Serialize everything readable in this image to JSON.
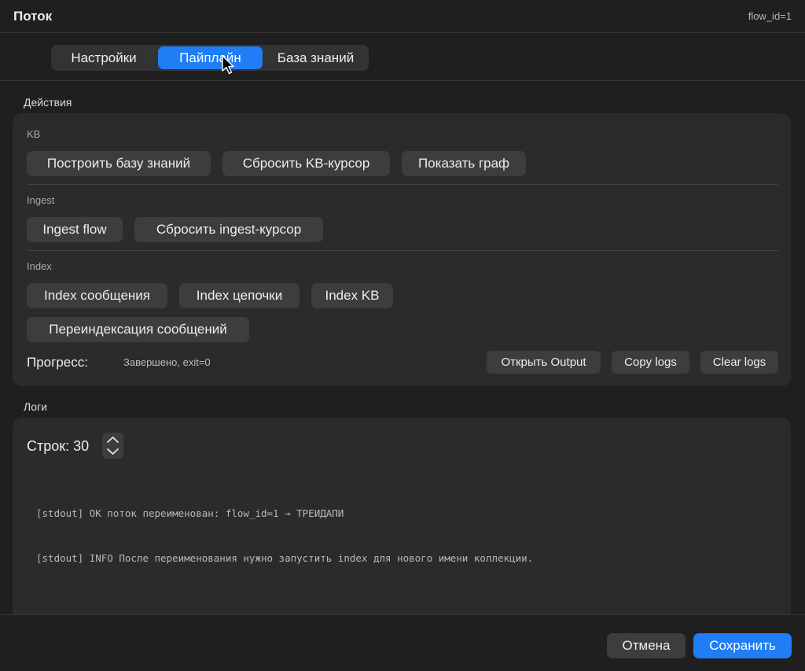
{
  "window": {
    "title": "Поток",
    "flow_id": "flow_id=1"
  },
  "tabs": [
    {
      "label": "Настройки",
      "active": false
    },
    {
      "label": "Пайплайн",
      "active": true
    },
    {
      "label": "База знаний",
      "active": false
    }
  ],
  "actions": {
    "section_label": "Действия",
    "kb": {
      "label": "KB",
      "buttons": [
        "Построить базу знаний",
        "Сбросить KB-курсор",
        "Показать граф"
      ]
    },
    "ingest": {
      "label": "Ingest",
      "buttons": [
        "Ingest flow",
        "Сбросить ingest-курсор"
      ]
    },
    "index": {
      "label": "Index",
      "buttons": [
        "Index сообщения",
        "Index цепочки",
        "Index KB",
        "Переиндексация сообщений"
      ]
    },
    "progress": {
      "label": "Прогресс:",
      "status": "Завершено, exit=0"
    },
    "log_buttons": [
      "Открыть Output",
      "Copy logs",
      "Clear logs"
    ]
  },
  "logs": {
    "section_label": "Логи",
    "rows_label": "Строк: 30",
    "lines": [
      "[stdout] OK поток переименован: flow_id=1 → ТРЕИДАПИ",
      "[stdout] INFO После переименования нужно запустить index для нового имени коллекции."
    ]
  },
  "footer": {
    "cancel": "Отмена",
    "save": "Сохранить"
  },
  "colors": {
    "accent": "#1f7ef5",
    "background": "#1f1f1f",
    "panel": "#2b2b2b",
    "button": "#3d3d3d"
  }
}
